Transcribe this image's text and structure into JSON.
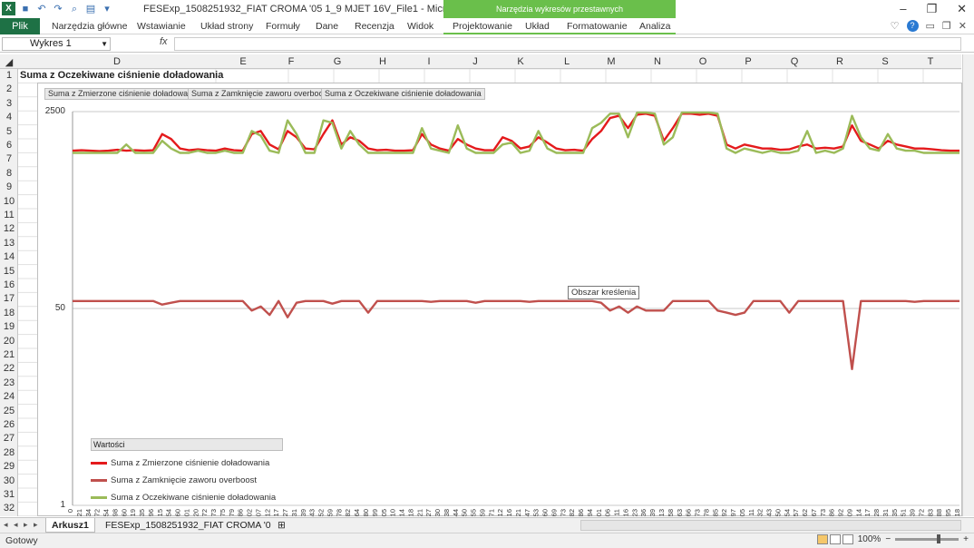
{
  "window": {
    "title": "FESExp_1508251932_FIAT CROMA '05 1_9 MJET 16V_File1  -  Microsoft Excel",
    "context_band": "Narzędzia wykresów przestawnych",
    "minimize": "–",
    "restore": "❐",
    "close": "✕"
  },
  "ribbon": {
    "file_tab": "Plik",
    "tabs": [
      "Narzędzia główne",
      "Wstawianie",
      "Układ strony",
      "Formuły",
      "Dane",
      "Recenzja",
      "Widok",
      "Projektowanie",
      "Układ",
      "Formatowanie",
      "Analiza"
    ]
  },
  "formula_bar": {
    "name_box": "Wykres 1",
    "fx": "fx",
    "value": ""
  },
  "columns": [
    "D",
    "E",
    "F",
    "G",
    "H",
    "I",
    "J",
    "K",
    "L",
    "M",
    "N",
    "O",
    "P",
    "Q",
    "R",
    "S",
    "T"
  ],
  "rows": [
    "1",
    "2",
    "3",
    "4",
    "5",
    "6",
    "7",
    "8",
    "9",
    "10",
    "11",
    "12",
    "13",
    "14",
    "15",
    "16",
    "17",
    "18",
    "19",
    "20",
    "21",
    "22",
    "23",
    "24",
    "25",
    "26",
    "27",
    "28",
    "29",
    "30",
    "31",
    "32"
  ],
  "cell_D1": "Suma z Oczekiwane ciśnienie doładowania",
  "field_buttons": [
    "Suma z Zmierzone ciśnienie doładowania",
    "Suma z Zamknięcie zaworu overboost",
    "Suma z Oczekiwane ciśnienie doładowania"
  ],
  "tooltip": "Obszar kreślenia",
  "legend": {
    "header": "Wartości",
    "items": [
      {
        "label": "Suma z Zmierzone ciśnienie doładowania",
        "color": "#e41a1c"
      },
      {
        "label": "Suma z Zamknięcie zaworu overboost",
        "color": "#c0504d"
      },
      {
        "label": "Suma z Oczekiwane ciśnienie doładowania",
        "color": "#9bbb59"
      }
    ]
  },
  "chart_data": {
    "type": "line",
    "scale": "log",
    "y_ticks": [
      "2500",
      "50",
      "1"
    ],
    "ylim": [
      1,
      2500
    ],
    "series": [
      {
        "name": "Suma z Zmierzone ciśnienie doładowania",
        "color": "#e41a1c",
        "values": [
          1150,
          1160,
          1150,
          1140,
          1150,
          1170,
          1150,
          1160,
          1150,
          1160,
          1600,
          1450,
          1200,
          1160,
          1180,
          1160,
          1150,
          1200,
          1160,
          1150,
          1600,
          1700,
          1300,
          1180,
          1700,
          1500,
          1200,
          1180,
          1600,
          2100,
          1300,
          1500,
          1400,
          1200,
          1160,
          1170,
          1150,
          1150,
          1160,
          1600,
          1300,
          1200,
          1150,
          1450,
          1300,
          1200,
          1160,
          1160,
          1500,
          1400,
          1200,
          1250,
          1500,
          1350,
          1200,
          1160,
          1170,
          1150,
          1450,
          1700,
          2200,
          2300,
          1800,
          2350,
          2400,
          2300,
          1400,
          1800,
          2400,
          2400,
          2350,
          2400,
          2300,
          1300,
          1200,
          1300,
          1250,
          1200,
          1200,
          1170,
          1180,
          1250,
          1300,
          1200,
          1220,
          1200,
          1250,
          1900,
          1400,
          1300,
          1200,
          1400,
          1300,
          1250,
          1200,
          1200,
          1180,
          1160,
          1150,
          1150
        ]
      },
      {
        "name": "Suma z Zamknięcie zaworu overboost",
        "color": "#c0504d",
        "values": [
          58,
          58,
          58,
          58,
          58,
          58,
          58,
          58,
          58,
          58,
          54,
          56,
          58,
          58,
          58,
          58,
          58,
          58,
          58,
          58,
          48,
          52,
          44,
          58,
          42,
          56,
          58,
          58,
          58,
          55,
          58,
          58,
          58,
          46,
          58,
          58,
          58,
          58,
          58,
          58,
          57,
          58,
          58,
          58,
          58,
          56,
          58,
          58,
          58,
          58,
          58,
          57,
          58,
          58,
          58,
          58,
          58,
          58,
          58,
          56,
          48,
          52,
          46,
          52,
          48,
          48,
          48,
          58,
          58,
          58,
          58,
          58,
          48,
          46,
          44,
          46,
          58,
          58,
          58,
          58,
          46,
          58,
          58,
          58,
          58,
          58,
          58,
          15,
          58,
          58,
          58,
          58,
          58,
          58,
          57,
          58,
          58,
          58,
          58,
          58
        ]
      },
      {
        "name": "Suma z Oczekiwane ciśnienie doładowania",
        "color": "#9bbb59",
        "values": [
          1100,
          1100,
          1100,
          1100,
          1100,
          1100,
          1300,
          1100,
          1100,
          1100,
          1400,
          1200,
          1100,
          1100,
          1150,
          1100,
          1100,
          1150,
          1100,
          1100,
          1700,
          1550,
          1150,
          1100,
          2100,
          1600,
          1100,
          1100,
          2100,
          2000,
          1200,
          1700,
          1300,
          1100,
          1100,
          1100,
          1100,
          1100,
          1100,
          1800,
          1200,
          1150,
          1100,
          1900,
          1200,
          1100,
          1100,
          1100,
          1300,
          1350,
          1100,
          1150,
          1700,
          1200,
          1100,
          1100,
          1100,
          1100,
          1800,
          2000,
          2400,
          2400,
          1500,
          2450,
          2450,
          2400,
          1300,
          1500,
          2450,
          2450,
          2450,
          2450,
          2400,
          1200,
          1100,
          1200,
          1150,
          1100,
          1150,
          1100,
          1100,
          1150,
          1700,
          1100,
          1150,
          1100,
          1200,
          2300,
          1500,
          1200,
          1150,
          1600,
          1200,
          1150,
          1150,
          1100,
          1100,
          1100,
          1100,
          1100
        ]
      }
    ],
    "x_tick_labels": [
      "0",
      "21",
      "34",
      "72",
      "54",
      "98",
      "60",
      "19",
      "35",
      "96",
      "15",
      "54",
      "60",
      "01",
      "20",
      "72",
      "73",
      "75",
      "79",
      "86",
      "02",
      "07",
      "12",
      "17",
      "27",
      "31",
      "39",
      "43",
      "52",
      "59",
      "78",
      "82",
      "64",
      "80",
      "99",
      "05",
      "10",
      "14",
      "18",
      "21",
      "27",
      "30",
      "38",
      "44",
      "50",
      "55",
      "59",
      "71",
      "12",
      "16",
      "21",
      "47",
      "53",
      "60",
      "69",
      "73",
      "82",
      "86",
      "94",
      "01",
      "06",
      "11",
      "16",
      "23",
      "36",
      "39",
      "13",
      "58",
      "63",
      "66",
      "73",
      "78",
      "85",
      "92",
      "97",
      "05",
      "11",
      "32",
      "43",
      "50",
      "54",
      "57",
      "62",
      "67",
      "73",
      "86",
      "92",
      "09",
      "14",
      "17",
      "28",
      "31",
      "35",
      "51",
      "39",
      "72",
      "83",
      "88",
      "95",
      "18"
    ]
  },
  "sheets": {
    "active": "Arkusz1",
    "other": "FESExp_1508251932_FIAT CROMA '0",
    "nav": "◂ ◂ ▸ ▸"
  },
  "status": {
    "ready": "Gotowy",
    "zoom": "100%",
    "minus": "−",
    "plus": "+"
  }
}
